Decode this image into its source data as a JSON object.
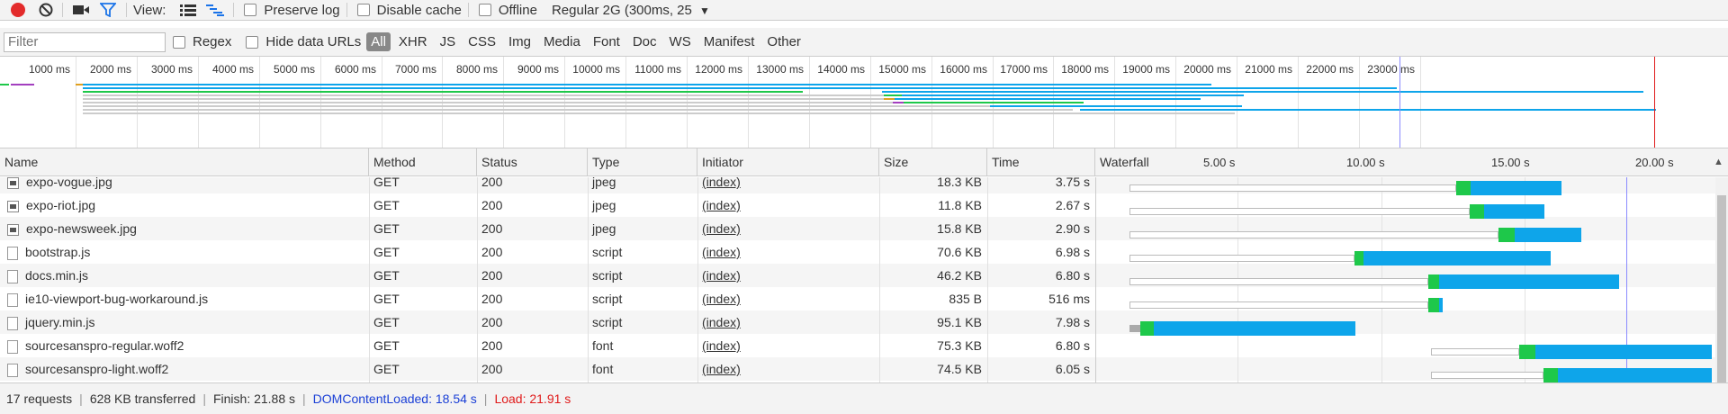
{
  "toolbar": {
    "view_label": "View:",
    "preserve_log": "Preserve log",
    "disable_cache": "Disable cache",
    "offline": "Offline",
    "throttle": "Regular 2G (300ms, 25",
    "colors": {
      "record": "#e32b2b",
      "filter_active": "#1a73e8"
    }
  },
  "filterbar": {
    "placeholder": "Filter",
    "regex": "Regex",
    "hide_data_urls": "Hide data URLs",
    "types": [
      "All",
      "XHR",
      "JS",
      "CSS",
      "Img",
      "Media",
      "Font",
      "Doc",
      "WS",
      "Manifest",
      "Other"
    ]
  },
  "overview": {
    "ticks": [
      "1000 ms",
      "2000 ms",
      "3000 ms",
      "4000 ms",
      "5000 ms",
      "6000 ms",
      "7000 ms",
      "8000 ms",
      "9000 ms",
      "10000 ms",
      "11000 ms",
      "12000 ms",
      "13000 ms",
      "14000 ms",
      "15000 ms",
      "16000 ms",
      "17000 ms",
      "18000 ms",
      "19000 ms",
      "20000 ms",
      "21000 ms",
      "22000 ms",
      "23000 ms"
    ]
  },
  "columns": {
    "name": "Name",
    "method": "Method",
    "status": "Status",
    "type": "Type",
    "initiator": "Initiator",
    "size": "Size",
    "time": "Time",
    "waterfall": "Waterfall",
    "wf_ticks": [
      "5.00 s",
      "10.00 s",
      "15.00 s",
      "20.00 s"
    ]
  },
  "rows": [
    {
      "name": "expo-vogue.jpg",
      "icon": "image-icon",
      "method": "GET",
      "status": "200",
      "type": "jpeg",
      "initiator": "(index)",
      "size": "18.3 KB",
      "time": "3.75 s"
    },
    {
      "name": "expo-riot.jpg",
      "icon": "image-icon",
      "method": "GET",
      "status": "200",
      "type": "jpeg",
      "initiator": "(index)",
      "size": "11.8 KB",
      "time": "2.67 s"
    },
    {
      "name": "expo-newsweek.jpg",
      "icon": "image-icon",
      "method": "GET",
      "status": "200",
      "type": "jpeg",
      "initiator": "(index)",
      "size": "15.8 KB",
      "time": "2.90 s"
    },
    {
      "name": "bootstrap.js",
      "icon": "file-icon",
      "method": "GET",
      "status": "200",
      "type": "script",
      "initiator": "(index)",
      "size": "70.6 KB",
      "time": "6.98 s"
    },
    {
      "name": "docs.min.js",
      "icon": "file-icon",
      "method": "GET",
      "status": "200",
      "type": "script",
      "initiator": "(index)",
      "size": "46.2 KB",
      "time": "6.80 s"
    },
    {
      "name": "ie10-viewport-bug-workaround.js",
      "icon": "file-icon",
      "method": "GET",
      "status": "200",
      "type": "script",
      "initiator": "(index)",
      "size": "835 B",
      "time": "516 ms"
    },
    {
      "name": "jquery.min.js",
      "icon": "file-icon",
      "method": "GET",
      "status": "200",
      "type": "script",
      "initiator": "(index)",
      "size": "95.1 KB",
      "time": "7.98 s"
    },
    {
      "name": "sourcesanspro-regular.woff2",
      "icon": "file-icon",
      "method": "GET",
      "status": "200",
      "type": "font",
      "initiator": "(index)",
      "size": "75.3 KB",
      "time": "6.80 s"
    },
    {
      "name": "sourcesanspro-light.woff2",
      "icon": "file-icon",
      "method": "GET",
      "status": "200",
      "type": "font",
      "initiator": "(index)",
      "size": "74.5 KB",
      "time": "6.05 s"
    }
  ],
  "status": {
    "requests": "17 requests",
    "transferred": "628 KB transferred",
    "finish": "Finish: 21.88 s",
    "dcl": "DOMContentLoaded: 18.54 s",
    "load": "Load: 21.91 s",
    "colors": {
      "dcl": "#1a3fd6",
      "load": "#e01b1b"
    }
  }
}
